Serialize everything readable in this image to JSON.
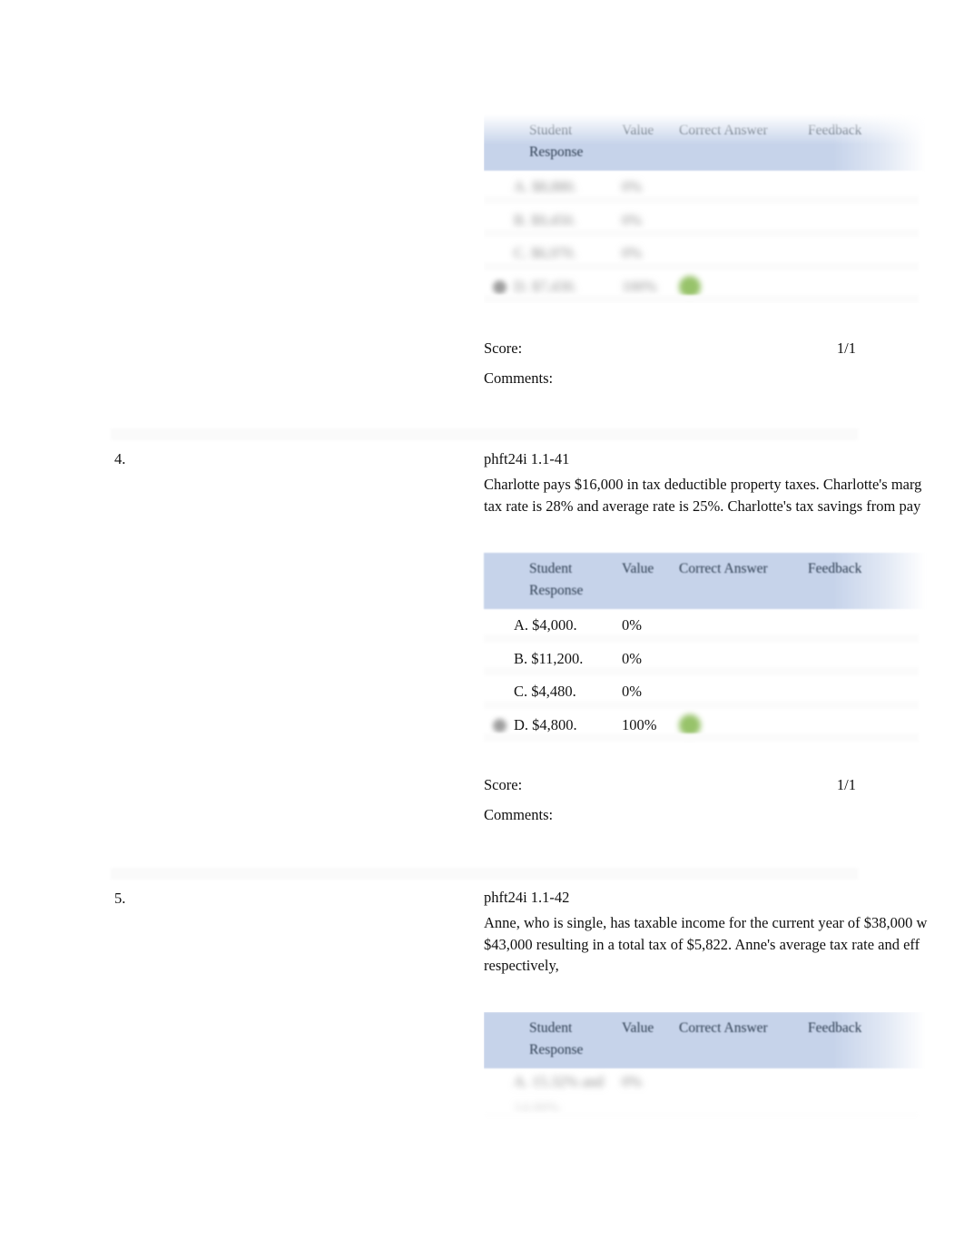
{
  "document": {
    "kind": "graded-quiz-review",
    "table_columns": {
      "student_response": "Student",
      "student_response_line2": "Response",
      "value": "Value",
      "correct_answer": "Correct Answer",
      "feedback": "Feedback"
    },
    "labels": {
      "score": "Score:",
      "comments": "Comments:"
    }
  },
  "questions": [
    {
      "number": "",
      "code": "",
      "text_lines": [],
      "options": [
        {
          "label": "",
          "value": "",
          "selected": false,
          "correct": false,
          "redacted": true
        },
        {
          "label": "",
          "value": "",
          "selected": false,
          "correct": false,
          "redacted": true
        },
        {
          "label": "",
          "value": "",
          "selected": false,
          "correct": false,
          "redacted": true
        },
        {
          "label": "",
          "value": "",
          "selected": true,
          "correct": true,
          "redacted": true
        }
      ],
      "score": "1/1",
      "comments": ""
    },
    {
      "number": "4.",
      "code": "phft24i 1.1-41",
      "text_lines": [
        "Charlotte pays $16,000 in tax deductible property taxes. Charlotte's marg",
        "tax rate is 28% and average rate is 25%. Charlotte's tax savings from pay"
      ],
      "options": [
        {
          "label": "A. $4,000.",
          "value": "0%",
          "selected": false,
          "correct": false,
          "redacted": false
        },
        {
          "label": "B. $11,200.",
          "value": "0%",
          "selected": false,
          "correct": false,
          "redacted": false
        },
        {
          "label": "C. $4,480.",
          "value": "0%",
          "selected": false,
          "correct": false,
          "redacted": false
        },
        {
          "label": "D. $4,800.",
          "value": "100%",
          "selected": true,
          "correct": true,
          "redacted": false
        }
      ],
      "score": "1/1",
      "comments": ""
    },
    {
      "number": "5.",
      "code": "phft24i 1.1-42",
      "text_lines": [
        "Anne, who is single, has taxable income for the current year of $38,000 w",
        "$43,000 resulting in a total tax of $5,822. Anne's average tax rate and eff",
        "respectively,"
      ],
      "options": [
        {
          "label": "",
          "value": "",
          "selected": false,
          "correct": false,
          "redacted": true
        }
      ],
      "score": "",
      "comments": ""
    }
  ],
  "colors": {
    "table_header_bg": "#c6d3ea",
    "table_header_text": "#2e3e52",
    "correct_marker": "#8fbe5e",
    "separator_band": "#fafafa",
    "page_bg": "#ffffff",
    "body_text": "#101010"
  }
}
